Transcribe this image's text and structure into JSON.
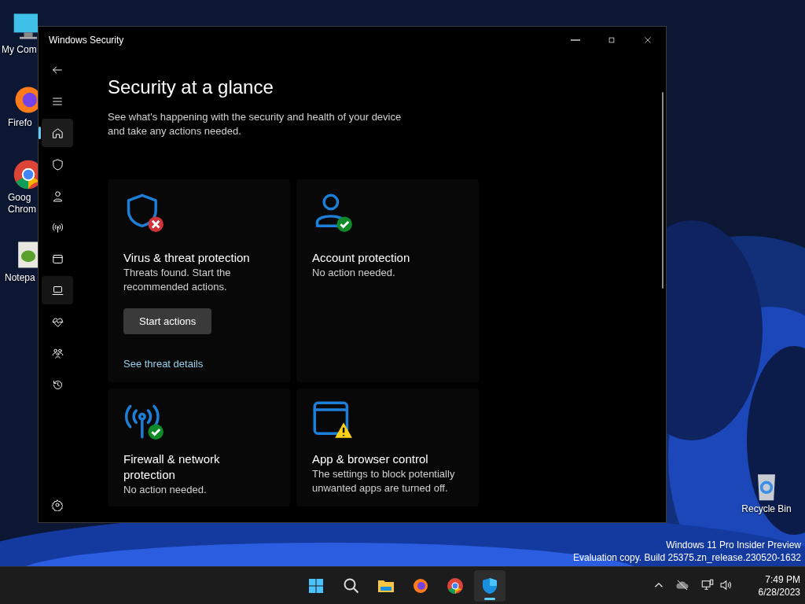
{
  "desktop_icons": [
    {
      "kind": "computer",
      "lines": [
        "My Com"
      ]
    },
    {
      "kind": "firefox",
      "lines": [
        "Firefo"
      ]
    },
    {
      "kind": "chrome",
      "lines": [
        "Goog",
        "Chrom"
      ]
    },
    {
      "kind": "notepad",
      "lines": [
        "Notepa"
      ]
    },
    {
      "kind": "recycle",
      "lines": [
        "Recycle Bin"
      ]
    }
  ],
  "window": {
    "title": "Windows Security",
    "nav": [
      {
        "kind": "home",
        "selected": true,
        "hovered": false
      },
      {
        "kind": "shield",
        "selected": false,
        "hovered": false
      },
      {
        "kind": "person",
        "selected": false,
        "hovered": false
      },
      {
        "kind": "antenna",
        "selected": false,
        "hovered": false
      },
      {
        "kind": "app",
        "selected": false,
        "hovered": false
      },
      {
        "kind": "laptop",
        "selected": false,
        "hovered": true
      },
      {
        "kind": "heart",
        "selected": false,
        "hovered": false
      },
      {
        "kind": "family",
        "selected": false,
        "hovered": false
      },
      {
        "kind": "history",
        "selected": false,
        "hovered": false
      }
    ],
    "heading": "Security at a glance",
    "subtitle": "See what's happening with the security and health of your device and take any actions needed.",
    "cards": [
      {
        "kind": "shield",
        "ok": false,
        "warning": false,
        "title": "Virus & threat protection",
        "description": "Threats found. Start the recommended actions.",
        "button": "Start actions",
        "link": "See threat details"
      },
      {
        "kind": "person",
        "ok": true,
        "warning": false,
        "title": "Account protection",
        "description": "No action needed."
      },
      {
        "kind": "antenna",
        "ok": true,
        "warning": false,
        "title": "Firewall & network protection",
        "description": "No action needed."
      },
      {
        "kind": "app",
        "ok": false,
        "warning": true,
        "title": "App & browser control",
        "description": "The settings to block potentially unwanted apps are turned off."
      }
    ]
  },
  "watermark": [
    "Windows 11 Pro Insider Preview",
    "Evaluation copy. Build 25375.zn_release.230520-1632"
  ],
  "taskbar": {
    "apps": [
      {
        "kind": "start",
        "active": false
      },
      {
        "kind": "search",
        "active": false
      },
      {
        "kind": "folder",
        "active": false
      },
      {
        "kind": "firefox",
        "active": false
      },
      {
        "kind": "chrome",
        "active": false
      },
      {
        "kind": "security",
        "active": true
      }
    ],
    "tray": {
      "time": "7:49 PM",
      "date": "6/28/2023"
    }
  }
}
